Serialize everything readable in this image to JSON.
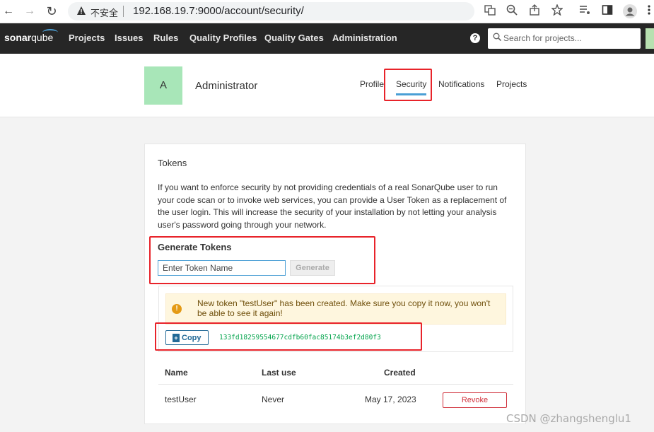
{
  "browser": {
    "back": "←",
    "forward": "→",
    "reload": "↻",
    "insecure_label": "不安全",
    "url": "192.168.19.7:9000/account/security/",
    "icons": [
      "translate-icon",
      "zoom-icon",
      "share-icon",
      "star-icon",
      "reading-list-icon",
      "sidebar-icon",
      "profile-icon",
      "menu-icon"
    ]
  },
  "topnav": {
    "logo_sonar": "sonar",
    "logo_qube": "qube",
    "items": [
      "Projects",
      "Issues",
      "Rules",
      "Quality Profiles",
      "Quality Gates",
      "Administration"
    ],
    "help": "?",
    "search_placeholder": "Search for projects..."
  },
  "account": {
    "avatar_letter": "A",
    "name": "Administrator",
    "tabs": [
      "Profile",
      "Security",
      "Notifications",
      "Projects"
    ],
    "active_tab": "Security"
  },
  "tokens": {
    "title": "Tokens",
    "description": "If you want to enforce security by not providing credentials of a real SonarQube user to run your code scan or to invoke web services, you can provide a User Token as a replacement of the user login. This will increase the security of your installation by not letting your analysis user's password going through your network.",
    "generate_title": "Generate Tokens",
    "input_placeholder": "Enter Token Name",
    "generate_label": "Generate",
    "alert_text": "New token \"testUser\" has been created. Make sure you copy it now, you won't be able to see it again!",
    "copy_label": "Copy",
    "token_value": "133fd18259554677cdfb60fac85174b3ef2d80f3",
    "columns": [
      "Name",
      "Last use",
      "Created"
    ],
    "rows": [
      {
        "name": "testUser",
        "last_use": "Never",
        "created": "May 17, 2023",
        "action": "Revoke"
      }
    ]
  },
  "watermark": "CSDN @zhangshenglu1",
  "colors": {
    "nav_bg": "#262626",
    "accent": "#4b9fd5",
    "annotation": "#e8232a",
    "danger": "#d02f3a"
  }
}
